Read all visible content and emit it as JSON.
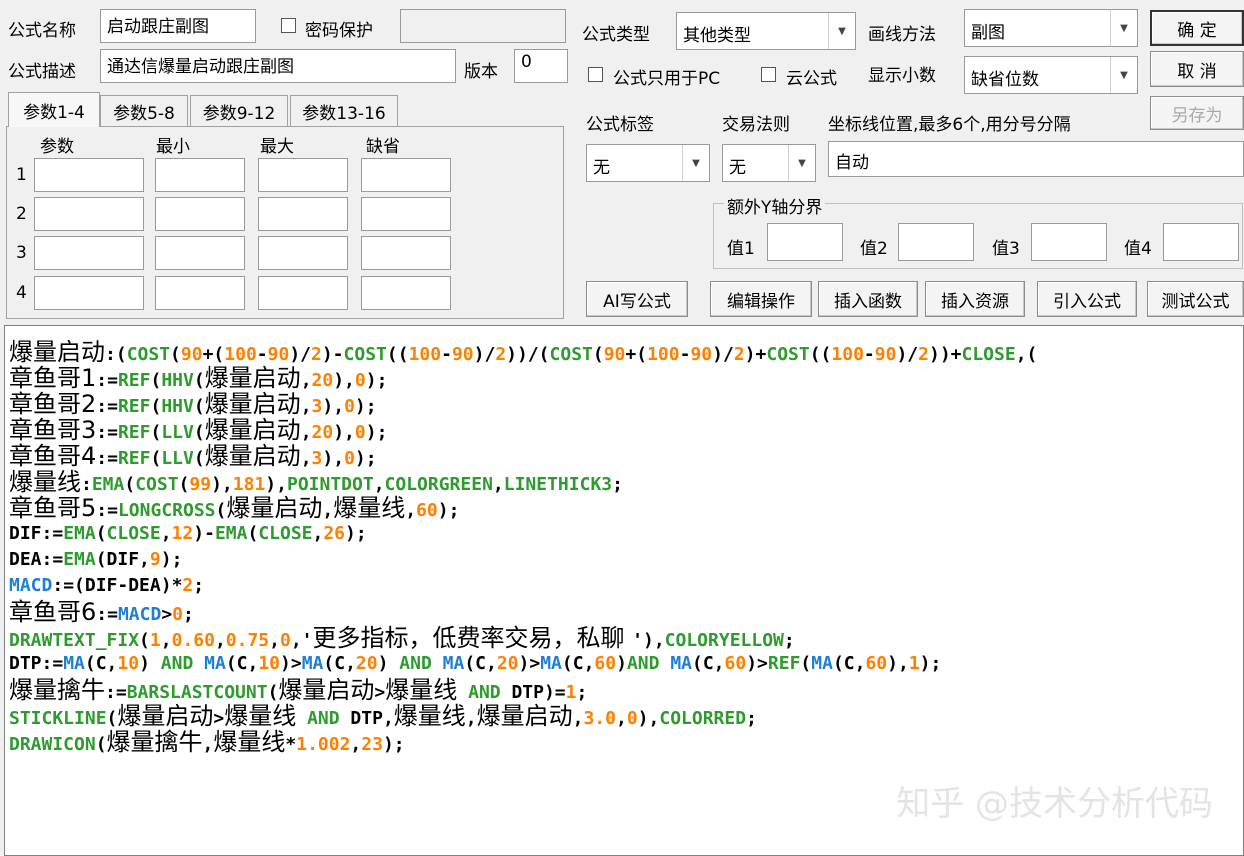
{
  "form": {
    "name_label": "公式名称",
    "name_value": "启动跟庄副图",
    "password_label": "密码保护",
    "desc_label": "公式描述",
    "desc_value": "通达信爆量启动跟庄副图",
    "version_label": "版本",
    "version_value": "0",
    "type_label": "公式类型",
    "type_value": "其他类型",
    "draw_label": "画线方法",
    "draw_value": "副图",
    "pc_only_label": "公式只用于PC",
    "cloud_label": "云公式",
    "decimals_label": "显示小数",
    "decimals_value": "缺省位数",
    "tag_label": "公式标签",
    "tag_value": "无",
    "trade_label": "交易法则",
    "trade_value": "无",
    "coord_label": "坐标线位置,最多6个,用分号分隔",
    "coord_value": "自动",
    "yaxis_group_label": "额外Y轴分界",
    "y_values": [
      "值1",
      "值2",
      "值3",
      "值4"
    ]
  },
  "buttons": {
    "ok": "确  定",
    "cancel": "取  消",
    "save_as": "另存为",
    "ai": "AI写公式",
    "edit": "编辑操作",
    "insert_func": "插入函数",
    "insert_res": "插入资源",
    "import": "引入公式",
    "test": "测试公式"
  },
  "params": {
    "tabs": [
      "参数1-4",
      "参数5-8",
      "参数9-12",
      "参数13-16"
    ],
    "headers": [
      "参数",
      "最小",
      "最大",
      "缺省"
    ],
    "rows": [
      "1",
      "2",
      "3",
      "4"
    ]
  },
  "code": {
    "line0": [
      [
        "爆量启动",
        "cjk",
        "#000000"
      ],
      [
        ":(",
        "",
        "#000000"
      ],
      [
        "COST",
        "",
        "#2e9b2e"
      ],
      [
        "(",
        "",
        "#000000"
      ],
      [
        "90",
        "",
        "#ff8000"
      ],
      [
        "+(",
        "",
        "#000000"
      ],
      [
        "100",
        "",
        "#ff8000"
      ],
      [
        "-",
        "",
        "#000000"
      ],
      [
        "90",
        "",
        "#ff8000"
      ],
      [
        ")/",
        "",
        "#000000"
      ],
      [
        "2",
        "",
        "#ff8000"
      ],
      [
        ")-",
        "",
        "#000000"
      ],
      [
        "COST",
        "",
        "#2e9b2e"
      ],
      [
        "((",
        "",
        "#000000"
      ],
      [
        "100",
        "",
        "#ff8000"
      ],
      [
        "-",
        "",
        "#000000"
      ],
      [
        "90",
        "",
        "#ff8000"
      ],
      [
        ")/",
        "",
        "#000000"
      ],
      [
        "2",
        "",
        "#ff8000"
      ],
      [
        "))/(",
        "",
        "#000000"
      ],
      [
        "COST",
        "",
        "#2e9b2e"
      ],
      [
        "(",
        "",
        "#000000"
      ],
      [
        "90",
        "",
        "#ff8000"
      ],
      [
        "+(",
        "",
        "#000000"
      ],
      [
        "100",
        "",
        "#ff8000"
      ],
      [
        "-",
        "",
        "#000000"
      ],
      [
        "90",
        "",
        "#ff8000"
      ],
      [
        ")/",
        "",
        "#000000"
      ],
      [
        "2",
        "",
        "#ff8000"
      ],
      [
        ")+",
        "",
        "#000000"
      ],
      [
        "COST",
        "",
        "#2e9b2e"
      ],
      [
        "((",
        "",
        "#000000"
      ],
      [
        "100",
        "",
        "#ff8000"
      ],
      [
        "-",
        "",
        "#000000"
      ],
      [
        "90",
        "",
        "#ff8000"
      ],
      [
        ")/",
        "",
        "#000000"
      ],
      [
        "2",
        "",
        "#ff8000"
      ],
      [
        "))+",
        "",
        "#000000"
      ],
      [
        "CLOSE",
        "",
        "#2e9b2e"
      ],
      [
        ",(",
        "",
        "#000000"
      ]
    ],
    "line1": [
      [
        "章鱼哥1",
        "cjk",
        "#000000"
      ],
      [
        ":=",
        "",
        "#000000"
      ],
      [
        "REF",
        "",
        "#2e9b2e"
      ],
      [
        "(",
        "",
        "#000000"
      ],
      [
        "HHV",
        "",
        "#2e9b2e"
      ],
      [
        "(",
        "",
        "#000000"
      ],
      [
        "爆量启动",
        "cjk",
        "#000000"
      ],
      [
        ",",
        "",
        "#000000"
      ],
      [
        "20",
        "",
        "#ff8000"
      ],
      [
        "),",
        "",
        "#000000"
      ],
      [
        "0",
        "",
        "#ff8000"
      ],
      [
        ");",
        "",
        "#000000"
      ]
    ],
    "line2": [
      [
        "章鱼哥2",
        "cjk",
        "#000000"
      ],
      [
        ":=",
        "",
        "#000000"
      ],
      [
        "REF",
        "",
        "#2e9b2e"
      ],
      [
        "(",
        "",
        "#000000"
      ],
      [
        "HHV",
        "",
        "#2e9b2e"
      ],
      [
        "(",
        "",
        "#000000"
      ],
      [
        "爆量启动",
        "cjk",
        "#000000"
      ],
      [
        ",",
        "",
        "#000000"
      ],
      [
        "3",
        "",
        "#ff8000"
      ],
      [
        "),",
        "",
        "#000000"
      ],
      [
        "0",
        "",
        "#ff8000"
      ],
      [
        ");",
        "",
        "#000000"
      ]
    ],
    "line3": [
      [
        "章鱼哥3",
        "cjk",
        "#000000"
      ],
      [
        ":=",
        "",
        "#000000"
      ],
      [
        "REF",
        "",
        "#2e9b2e"
      ],
      [
        "(",
        "",
        "#000000"
      ],
      [
        "LLV",
        "",
        "#2e9b2e"
      ],
      [
        "(",
        "",
        "#000000"
      ],
      [
        "爆量启动",
        "cjk",
        "#000000"
      ],
      [
        ",",
        "",
        "#000000"
      ],
      [
        "20",
        "",
        "#ff8000"
      ],
      [
        "),",
        "",
        "#000000"
      ],
      [
        "0",
        "",
        "#ff8000"
      ],
      [
        ");",
        "",
        "#000000"
      ]
    ],
    "line4": [
      [
        "章鱼哥4",
        "cjk",
        "#000000"
      ],
      [
        ":=",
        "",
        "#000000"
      ],
      [
        "REF",
        "",
        "#2e9b2e"
      ],
      [
        "(",
        "",
        "#000000"
      ],
      [
        "LLV",
        "",
        "#2e9b2e"
      ],
      [
        "(",
        "",
        "#000000"
      ],
      [
        "爆量启动",
        "cjk",
        "#000000"
      ],
      [
        ",",
        "",
        "#000000"
      ],
      [
        "3",
        "",
        "#ff8000"
      ],
      [
        "),",
        "",
        "#000000"
      ],
      [
        "0",
        "",
        "#ff8000"
      ],
      [
        ");",
        "",
        "#000000"
      ]
    ],
    "line5": [
      [
        "爆量线",
        "cjk",
        "#000000"
      ],
      [
        ":",
        "",
        "#000000"
      ],
      [
        "EMA",
        "",
        "#2e9b2e"
      ],
      [
        "(",
        "",
        "#000000"
      ],
      [
        "COST",
        "",
        "#2e9b2e"
      ],
      [
        "(",
        "",
        "#000000"
      ],
      [
        "99",
        "",
        "#ff8000"
      ],
      [
        "),",
        "",
        "#000000"
      ],
      [
        "181",
        "",
        "#ff8000"
      ],
      [
        "),",
        "",
        "#000000"
      ],
      [
        "POINTDOT",
        "",
        "#2e9b2e"
      ],
      [
        ",",
        "",
        "#000000"
      ],
      [
        "COLORGREEN",
        "",
        "#2e9b2e"
      ],
      [
        ",",
        "",
        "#000000"
      ],
      [
        "LINETHICK3",
        "",
        "#2e9b2e"
      ],
      [
        ";",
        "",
        "#000000"
      ]
    ],
    "line6": [
      [
        "章鱼哥5",
        "cjk",
        "#000000"
      ],
      [
        ":=",
        "",
        "#000000"
      ],
      [
        "LONGCROSS",
        "",
        "#2e9b2e"
      ],
      [
        "(",
        "",
        "#000000"
      ],
      [
        "爆量启动",
        "cjk",
        "#000000"
      ],
      [
        ",",
        "",
        "#000000"
      ],
      [
        "爆量线",
        "cjk",
        "#000000"
      ],
      [
        ",",
        "",
        "#000000"
      ],
      [
        "60",
        "",
        "#ff8000"
      ],
      [
        ");",
        "",
        "#000000"
      ]
    ],
    "line7": [
      [
        "DIF:=",
        "",
        "#000000"
      ],
      [
        "EMA",
        "",
        "#2e9b2e"
      ],
      [
        "(",
        "",
        "#000000"
      ],
      [
        "CLOSE",
        "",
        "#2e9b2e"
      ],
      [
        ",",
        "",
        "#000000"
      ],
      [
        "12",
        "",
        "#ff8000"
      ],
      [
        ")-",
        "",
        "#000000"
      ],
      [
        "EMA",
        "",
        "#2e9b2e"
      ],
      [
        "(",
        "",
        "#000000"
      ],
      [
        "CLOSE",
        "",
        "#2e9b2e"
      ],
      [
        ",",
        "",
        "#000000"
      ],
      [
        "26",
        "",
        "#ff8000"
      ],
      [
        ");",
        "",
        "#000000"
      ]
    ],
    "line8": [
      [
        "DEA:=",
        "",
        "#000000"
      ],
      [
        "EMA",
        "",
        "#2e9b2e"
      ],
      [
        "(DIF,",
        "",
        "#000000"
      ],
      [
        "9",
        "",
        "#ff8000"
      ],
      [
        ");",
        "",
        "#000000"
      ]
    ],
    "line9": [
      [
        "MACD",
        "",
        "#1e7fd6"
      ],
      [
        ":=(DIF-DEA)*",
        "",
        "#000000"
      ],
      [
        "2",
        "",
        "#ff8000"
      ],
      [
        ";",
        "",
        "#000000"
      ]
    ],
    "line10": [
      [
        "章鱼哥6",
        "cjk",
        "#000000"
      ],
      [
        ":=",
        "",
        "#000000"
      ],
      [
        "MACD",
        "",
        "#1e7fd6"
      ],
      [
        ">",
        "",
        "#000000"
      ],
      [
        "0",
        "",
        "#ff8000"
      ],
      [
        ";",
        "",
        "#000000"
      ]
    ],
    "line11": [
      [
        "DRAWTEXT_FIX",
        "",
        "#2e9b2e"
      ],
      [
        "(",
        "",
        "#000000"
      ],
      [
        "1",
        "",
        "#ff8000"
      ],
      [
        ",",
        "",
        "#000000"
      ],
      [
        "0.60",
        "",
        "#ff8000"
      ],
      [
        ",",
        "",
        "#000000"
      ],
      [
        "0.75",
        "",
        "#ff8000"
      ],
      [
        ",",
        "",
        "#000000"
      ],
      [
        "0",
        "",
        "#ff8000"
      ],
      [
        ",'",
        "",
        "#000000"
      ],
      [
        "更多指标，低费率交易，私聊 ",
        "cjk",
        "#000000"
      ],
      [
        "'),",
        "",
        "#000000"
      ],
      [
        "COLORYELLOW",
        "",
        "#2e9b2e"
      ],
      [
        ";",
        "",
        "#000000"
      ]
    ],
    "line12": [
      [
        "DTP:=",
        "",
        "#000000"
      ],
      [
        "MA",
        "",
        "#1e7fd6"
      ],
      [
        "(C,",
        "",
        "#000000"
      ],
      [
        "10",
        "",
        "#ff8000"
      ],
      [
        ") ",
        "",
        "#000000"
      ],
      [
        "AND",
        "",
        "#2e9b2e"
      ],
      [
        " ",
        "",
        "#000000"
      ],
      [
        "MA",
        "",
        "#1e7fd6"
      ],
      [
        "(C,",
        "",
        "#000000"
      ],
      [
        "10",
        "",
        "#ff8000"
      ],
      [
        ")>",
        "",
        "#000000"
      ],
      [
        "MA",
        "",
        "#1e7fd6"
      ],
      [
        "(C,",
        "",
        "#000000"
      ],
      [
        "20",
        "",
        "#ff8000"
      ],
      [
        ") ",
        "",
        "#000000"
      ],
      [
        "AND",
        "",
        "#2e9b2e"
      ],
      [
        " ",
        "",
        "#000000"
      ],
      [
        "MA",
        "",
        "#1e7fd6"
      ],
      [
        "(C,",
        "",
        "#000000"
      ],
      [
        "20",
        "",
        "#ff8000"
      ],
      [
        ")>",
        "",
        "#000000"
      ],
      [
        "MA",
        "",
        "#1e7fd6"
      ],
      [
        "(C,",
        "",
        "#000000"
      ],
      [
        "60",
        "",
        "#ff8000"
      ],
      [
        ")",
        "",
        "#000000"
      ],
      [
        "AND",
        "",
        "#2e9b2e"
      ],
      [
        " ",
        "",
        "#000000"
      ],
      [
        "MA",
        "",
        "#1e7fd6"
      ],
      [
        "(C,",
        "",
        "#000000"
      ],
      [
        "60",
        "",
        "#ff8000"
      ],
      [
        ")>",
        "",
        "#000000"
      ],
      [
        "REF",
        "",
        "#2e9b2e"
      ],
      [
        "(",
        "",
        "#000000"
      ],
      [
        "MA",
        "",
        "#1e7fd6"
      ],
      [
        "(C,",
        "",
        "#000000"
      ],
      [
        "60",
        "",
        "#ff8000"
      ],
      [
        "),",
        "",
        "#000000"
      ],
      [
        "1",
        "",
        "#ff8000"
      ],
      [
        ");",
        "",
        "#000000"
      ]
    ],
    "line13": [
      [
        "爆量擒牛",
        "cjk",
        "#000000"
      ],
      [
        ":=",
        "",
        "#000000"
      ],
      [
        "BARSLASTCOUNT",
        "",
        "#2e9b2e"
      ],
      [
        "(",
        "",
        "#000000"
      ],
      [
        "爆量启动",
        "cjk",
        "#000000"
      ],
      [
        ">",
        "",
        "#000000"
      ],
      [
        "爆量线",
        "cjk",
        "#000000"
      ],
      [
        " ",
        "",
        "#000000"
      ],
      [
        "AND",
        "",
        "#2e9b2e"
      ],
      [
        " DTP)=",
        "",
        "#000000"
      ],
      [
        "1",
        "",
        "#ff8000"
      ],
      [
        ";",
        "",
        "#000000"
      ]
    ],
    "line14": [
      [
        "STICKLINE",
        "",
        "#2e9b2e"
      ],
      [
        "(",
        "",
        "#000000"
      ],
      [
        "爆量启动",
        "cjk",
        "#000000"
      ],
      [
        ">",
        "",
        "#000000"
      ],
      [
        "爆量线",
        "cjk",
        "#000000"
      ],
      [
        " ",
        "",
        "#000000"
      ],
      [
        "AND",
        "",
        "#2e9b2e"
      ],
      [
        " DTP,",
        "",
        "#000000"
      ],
      [
        "爆量线",
        "cjk",
        "#000000"
      ],
      [
        ",",
        "",
        "#000000"
      ],
      [
        "爆量启动",
        "cjk",
        "#000000"
      ],
      [
        ",",
        "",
        "#000000"
      ],
      [
        "3.0",
        "",
        "#ff8000"
      ],
      [
        ",",
        "",
        "#000000"
      ],
      [
        "0",
        "",
        "#ff8000"
      ],
      [
        "),",
        "",
        "#000000"
      ],
      [
        "COLORRED",
        "",
        "#2e9b2e"
      ],
      [
        ";",
        "",
        "#000000"
      ]
    ],
    "line15": [
      [
        "DRAWICON",
        "",
        "#2e9b2e"
      ],
      [
        "(",
        "",
        "#000000"
      ],
      [
        "爆量擒牛",
        "cjk",
        "#000000"
      ],
      [
        ",",
        "",
        "#000000"
      ],
      [
        "爆量线",
        "cjk",
        "#000000"
      ],
      [
        "*",
        "",
        "#000000"
      ],
      [
        "1.002",
        "",
        "#ff8000"
      ],
      [
        ",",
        "",
        "#000000"
      ],
      [
        "23",
        "",
        "#ff8000"
      ],
      [
        ");",
        "",
        "#000000"
      ]
    ]
  },
  "watermark": "知乎 @技术分析代码"
}
